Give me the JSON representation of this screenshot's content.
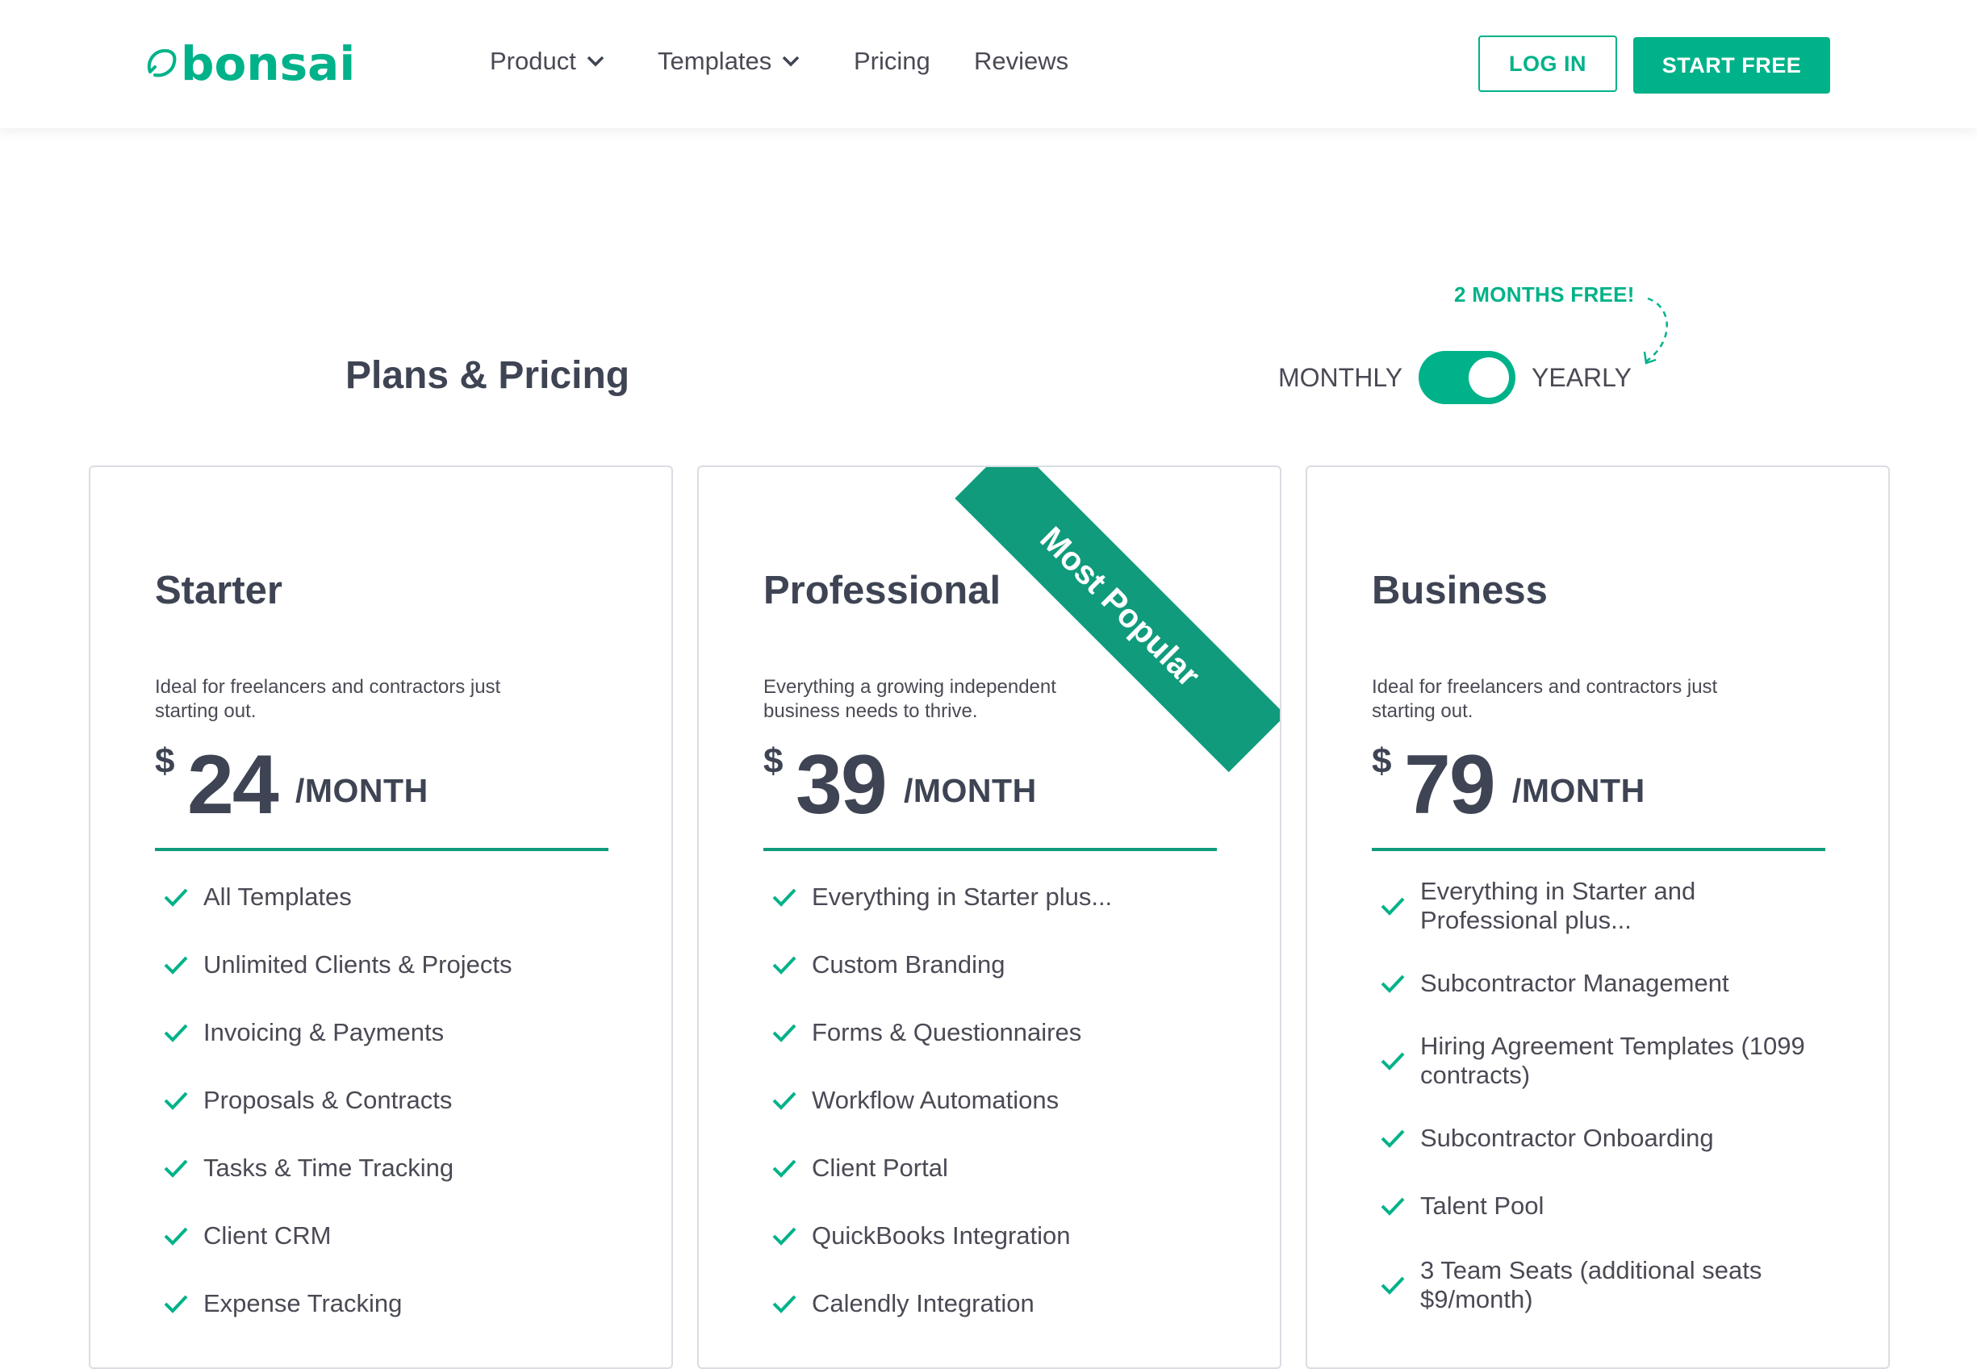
{
  "header": {
    "logo_text": "bonsai",
    "nav": [
      {
        "label": "Product"
      },
      {
        "label": "Templates"
      },
      {
        "label": "Pricing"
      },
      {
        "label": "Reviews"
      }
    ],
    "login_label": "LOG IN",
    "start_label": "START FREE"
  },
  "pricing": {
    "title": "Plans & Pricing",
    "promo": "2 MONTHS FREE!",
    "toggle": {
      "monthly": "MONTHLY",
      "yearly": "YEARLY",
      "selected": "YEARLY"
    }
  },
  "plans": [
    {
      "name": "Starter",
      "description": "Ideal for freelancers and contractors just starting out.",
      "currency": "$",
      "price": "24",
      "period": "/MONTH",
      "features": [
        "All Templates",
        "Unlimited Clients & Projects",
        "Invoicing & Payments",
        "Proposals & Contracts",
        "Tasks & Time Tracking",
        "Client CRM",
        "Expense Tracking"
      ]
    },
    {
      "name": "Professional",
      "badge": "Most Popular",
      "description": "Everything a growing independent business needs to thrive.",
      "currency": "$",
      "price": "39",
      "period": "/MONTH",
      "features": [
        "Everything in Starter plus...",
        "Custom Branding",
        "Forms & Questionnaires",
        "Workflow Automations",
        "Client Portal",
        "QuickBooks Integration",
        "Calendly Integration"
      ]
    },
    {
      "name": "Business",
      "description": "Ideal for freelancers and contractors just starting out.",
      "currency": "$",
      "price": "79",
      "period": "/MONTH",
      "features": [
        "Everything in Starter and Professional plus...",
        "Subcontractor Management",
        "Hiring Agreement Templates (1099 contracts)",
        "Subcontractor Onboarding",
        "Talent Pool",
        "3 Team Seats (additional seats $9/month)"
      ]
    }
  ],
  "colors": {
    "accent": "#00b289",
    "ribbon": "#0f9b7c",
    "text": "#3e4453"
  }
}
